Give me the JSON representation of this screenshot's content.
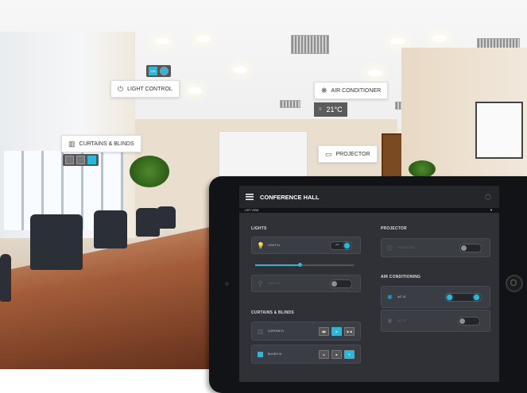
{
  "scene": {
    "tags": {
      "light_control": "LIGHT CONTROL",
      "curtains_blinds": "CURTAINS & BLINDS",
      "air_conditioner": "AIR CONDITIONER",
      "projector": "PROJECTOR"
    },
    "temperature": "21°C",
    "mini_light_label": "ON"
  },
  "app": {
    "title": "CONFERENCE HALL",
    "view_label": "LIST VIEW",
    "sections": {
      "lights": "LIGHTS",
      "curtains": "CURTAINS & BLINDS",
      "projector": "PROJECTOR",
      "air": "AIR CONDITIONING"
    },
    "lights": [
      {
        "label": "LIGHT 01",
        "state": "on",
        "toggle_text": "ON",
        "dimmer_level": 0.45
      },
      {
        "label": "LIGHT 02",
        "state": "off",
        "toggle_text": ""
      }
    ],
    "curtains": [
      {
        "label": "CURTAIN 01",
        "active_button": 2
      },
      {
        "label": "BLINDS 01",
        "active_button": 3
      }
    ],
    "projector": [
      {
        "label": "PROJECTOR",
        "state": "off"
      }
    ],
    "air": [
      {
        "label": "A/C 01",
        "state": "on"
      },
      {
        "label": "A/C 02",
        "state": "off"
      }
    ]
  },
  "colors": {
    "accent": "#2bb7d9",
    "bulb": "#f5b82e",
    "panel": "#2f3136"
  }
}
